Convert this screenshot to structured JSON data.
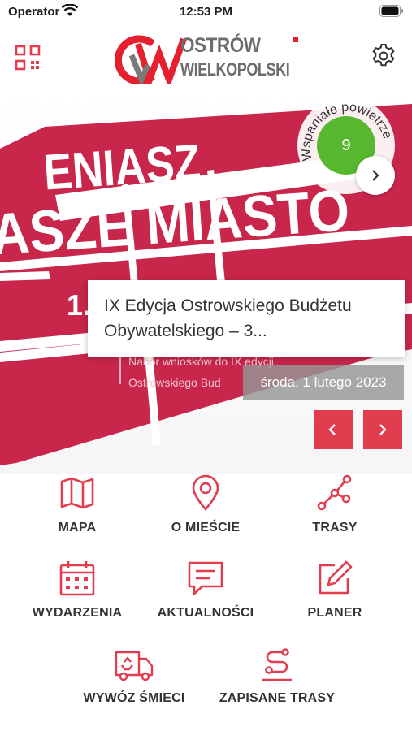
{
  "status_bar": {
    "carrier": "Operator",
    "time": "12:53 PM"
  },
  "header": {
    "logo_line1": "OSTRÓW",
    "logo_line2": "WIELKOPOLSKI"
  },
  "hero": {
    "banner_text_1": "ENIASZ",
    "banner_text_2": "ASZE MIASTO",
    "banner_number": "1.",
    "banner_subtext_1": "Nabór wniosków do IX edycji",
    "banner_subtext_2": "Ostrowskiego Bud"
  },
  "air_quality": {
    "label": "Wspaniałe powietrze",
    "value": "9",
    "color": "#57b82f"
  },
  "news": {
    "title": "IX Edycja Ostrowskiego Budżetu Obywatelskiego – 3...",
    "date": "środa, 1 lutego 2023"
  },
  "menu": {
    "items": [
      {
        "label": "MAPA",
        "icon": "map-icon"
      },
      {
        "label": "O MIEŚCIE",
        "icon": "location-pin-icon"
      },
      {
        "label": "TRASY",
        "icon": "route-icon"
      },
      {
        "label": "WYDARZENIA",
        "icon": "calendar-icon"
      },
      {
        "label": "AKTUALNOŚCI",
        "icon": "message-icon"
      },
      {
        "label": "PLANER",
        "icon": "edit-icon"
      },
      {
        "label": "WYWÓZ ŚMIECI",
        "icon": "garbage-truck-icon"
      },
      {
        "label": "ZAPISANE TRASY",
        "icon": "saved-route-icon"
      }
    ]
  },
  "colors": {
    "accent": "#e13d4f",
    "banner": "#c8264a"
  }
}
